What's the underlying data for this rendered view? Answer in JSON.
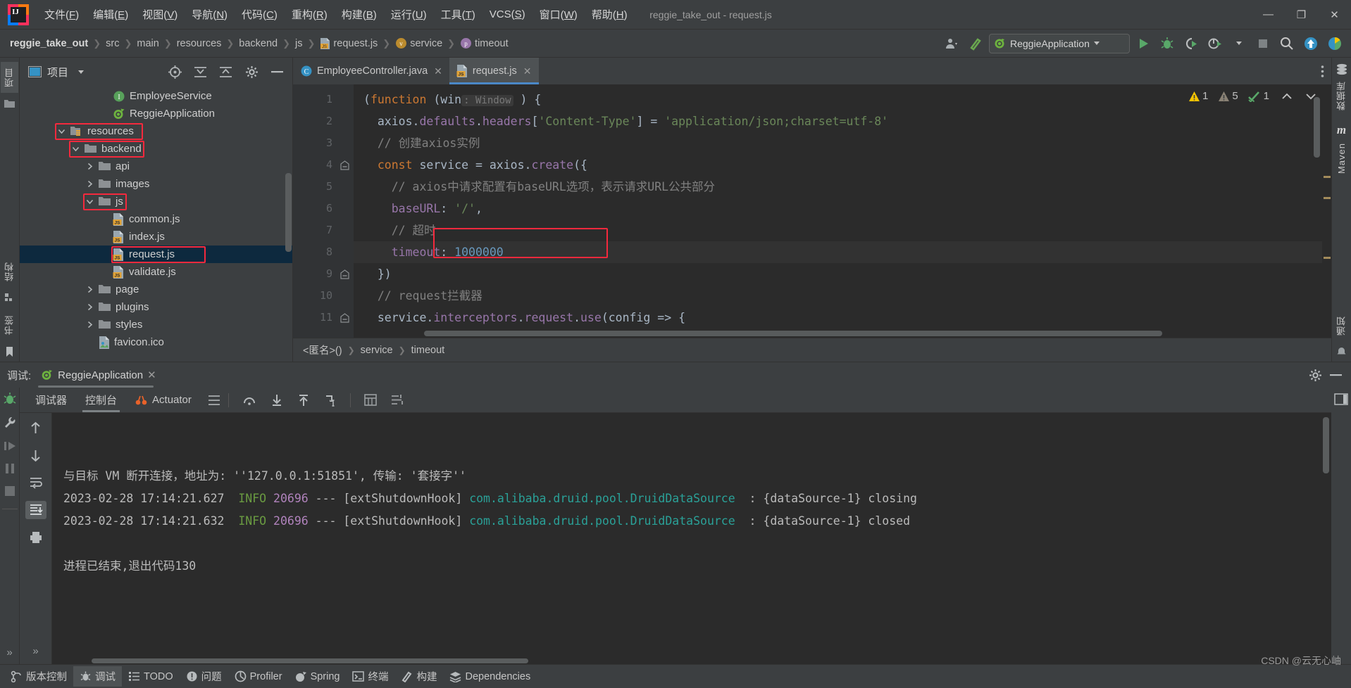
{
  "titlebar": {
    "menus": [
      {
        "label": "文件(F)",
        "mn": "F"
      },
      {
        "label": "编辑(E)",
        "mn": "E"
      },
      {
        "label": "视图(V)",
        "mn": "V"
      },
      {
        "label": "导航(N)",
        "mn": "N"
      },
      {
        "label": "代码(C)",
        "mn": "C"
      },
      {
        "label": "重构(R)",
        "mn": "R"
      },
      {
        "label": "构建(B)",
        "mn": "B"
      },
      {
        "label": "运行(U)",
        "mn": "U"
      },
      {
        "label": "工具(T)",
        "mn": "T"
      },
      {
        "label": "VCS(S)",
        "mn": "S"
      },
      {
        "label": "窗口(W)",
        "mn": "W"
      },
      {
        "label": "帮助(H)",
        "mn": "H"
      }
    ],
    "window_title": "reggie_take_out - request.js",
    "minimize": "—",
    "maximize": "❐",
    "close": "✕"
  },
  "navbar": {
    "crumbs": [
      "reggie_take_out",
      "src",
      "main",
      "resources",
      "backend",
      "js",
      "request.js",
      "service",
      "timeout"
    ],
    "run_config": "ReggieApplication",
    "icons": [
      "profile-icon",
      "hammer-icon",
      "run-icon",
      "debug-icon",
      "coverage-icon",
      "profiler-icon",
      "stop-icon",
      "search-icon",
      "update-icon",
      "ide-icon"
    ]
  },
  "project_panel": {
    "title": "项目",
    "tree": [
      {
        "label": "EmployeeService",
        "indent": 5,
        "icon": "interface-icon",
        "arrow": "none",
        "highlight": false
      },
      {
        "label": "ReggieApplication",
        "indent": 5,
        "icon": "spring-icon",
        "arrow": "none",
        "highlight": false
      },
      {
        "label": "resources",
        "indent": 2,
        "icon": "resource-folder-icon",
        "arrow": "down",
        "highlight": true
      },
      {
        "label": "backend",
        "indent": 3,
        "icon": "folder-icon",
        "arrow": "down",
        "highlight": true
      },
      {
        "label": "api",
        "indent": 4,
        "icon": "folder-icon",
        "arrow": "right",
        "highlight": false
      },
      {
        "label": "images",
        "indent": 4,
        "icon": "folder-icon",
        "arrow": "right",
        "highlight": false
      },
      {
        "label": "js",
        "indent": 4,
        "icon": "folder-icon",
        "arrow": "down",
        "highlight": true
      },
      {
        "label": "common.js",
        "indent": 5,
        "icon": "js-file-icon",
        "arrow": "none",
        "highlight": false
      },
      {
        "label": "index.js",
        "indent": 5,
        "icon": "js-file-icon",
        "arrow": "none",
        "highlight": false
      },
      {
        "label": "request.js",
        "indent": 5,
        "icon": "js-file-icon",
        "arrow": "none",
        "highlight": true,
        "selected": true
      },
      {
        "label": "validate.js",
        "indent": 5,
        "icon": "js-file-icon",
        "arrow": "none",
        "highlight": false
      },
      {
        "label": "page",
        "indent": 4,
        "icon": "folder-icon",
        "arrow": "right",
        "highlight": false
      },
      {
        "label": "plugins",
        "indent": 4,
        "icon": "folder-icon",
        "arrow": "right",
        "highlight": false
      },
      {
        "label": "styles",
        "indent": 4,
        "icon": "folder-icon",
        "arrow": "right",
        "highlight": false
      },
      {
        "label": "favicon.ico",
        "indent": 4,
        "icon": "image-file-icon",
        "arrow": "none",
        "highlight": false
      }
    ]
  },
  "editor": {
    "tabs": [
      {
        "label": "EmployeeController.java",
        "icon": "java-class-icon",
        "active": false
      },
      {
        "label": "request.js",
        "icon": "js-file-icon",
        "active": true
      }
    ],
    "lines": [
      {
        "n": "1",
        "fold": "",
        "cur": false,
        "html": "<span class=\"punct\">(</span><span class=\"kw\">function</span> <span class=\"punct\">(</span><span class=\"id\">win</span><span class=\"type-hint\">: Window</span> <span class=\"punct\">) {</span>"
      },
      {
        "n": "2",
        "fold": "",
        "cur": false,
        "html": "  <span class=\"id\">axios</span><span class=\"punct\">.</span><span class=\"prop\">defaults</span><span class=\"punct\">.</span><span class=\"prop\">headers</span><span class=\"punct\">[</span><span class=\"str\">'Content-Type'</span><span class=\"punct\">] = </span><span class=\"str\">'application/json;charset=utf-8'</span>"
      },
      {
        "n": "3",
        "fold": "",
        "cur": false,
        "html": "  <span class=\"cmt\">// 创建axios实例</span>"
      },
      {
        "n": "4",
        "fold": "-",
        "cur": false,
        "html": "  <span class=\"kw\">const</span> <span class=\"id\">service</span> <span class=\"punct\">=</span> <span class=\"id\">axios</span><span class=\"punct\">.</span><span class=\"prop\">create</span><span class=\"punct\">({</span>"
      },
      {
        "n": "5",
        "fold": "",
        "cur": false,
        "html": "    <span class=\"cmt\">// axios中请求配置有baseURL选项，表示请求URL公共部分</span>"
      },
      {
        "n": "6",
        "fold": "",
        "cur": false,
        "html": "    <span class=\"prop\">baseURL</span><span class=\"punct\">: </span><span class=\"str\">'/'</span><span class=\"punct\">,</span>"
      },
      {
        "n": "7",
        "fold": "",
        "cur": false,
        "html": "    <span class=\"cmt\">// 超时</span>"
      },
      {
        "n": "8",
        "fold": "",
        "cur": true,
        "html": "    <span class=\"prop\">timeout</span><span class=\"punct\">: </span><span class=\"num\">1000000</span>"
      },
      {
        "n": "9",
        "fold": "-",
        "cur": false,
        "html": "  <span class=\"punct\">})</span>"
      },
      {
        "n": "10",
        "fold": "",
        "cur": false,
        "html": "  <span class=\"cmt\">// request拦截器</span>"
      },
      {
        "n": "11",
        "fold": "-",
        "cur": false,
        "html": "  <span class=\"id\">service</span><span class=\"punct\">.</span><span class=\"prop\">interceptors</span><span class=\"punct\">.</span><span class=\"prop\">request</span><span class=\"punct\">.</span><span class=\"prop\">use</span><span class=\"punct\">(</span><span class=\"id\">config</span> <span class=\"punct\">=> {</span>"
      }
    ],
    "inspections": {
      "warnings": "1",
      "weak_warnings": "5",
      "typos": "1"
    },
    "breadcrumb": [
      "<匿名>()",
      "service",
      "timeout"
    ]
  },
  "debug": {
    "title": "调试:",
    "session": "ReggieApplication",
    "tabs": [
      {
        "label": "调试器",
        "icon": "",
        "active": false
      },
      {
        "label": "控制台",
        "icon": "",
        "active": true
      },
      {
        "label": "Actuator",
        "icon": "actuator-icon",
        "active": false
      }
    ],
    "console_lines": [
      [
        {
          "t": "与目标 VM 断开连接，地址为: ''127.0.0.1:51851', 传输: '套接字''",
          "c": "c-plain"
        }
      ],
      [
        {
          "t": "2023-02-28 17:14:21.627 ",
          "c": "c-plain"
        },
        {
          "t": " INFO",
          "c": "c-info"
        },
        {
          "t": " 20696",
          "c": "c-pid"
        },
        {
          "t": " --- [extShutdownHook] ",
          "c": "c-plain"
        },
        {
          "t": "com.alibaba.druid.pool.DruidDataSource",
          "c": "c-class"
        },
        {
          "t": "  : {dataSource-1} closing",
          "c": "c-plain"
        }
      ],
      [
        {
          "t": "2023-02-28 17:14:21.632 ",
          "c": "c-plain"
        },
        {
          "t": " INFO",
          "c": "c-info"
        },
        {
          "t": " 20696",
          "c": "c-pid"
        },
        {
          "t": " --- [extShutdownHook] ",
          "c": "c-plain"
        },
        {
          "t": "com.alibaba.druid.pool.DruidDataSource",
          "c": "c-class"
        },
        {
          "t": "  : {dataSource-1} closed",
          "c": "c-plain"
        }
      ],
      [],
      [
        {
          "t": "进程已结束,退出代码130",
          "c": "c-plain"
        }
      ]
    ]
  },
  "left_strips": {
    "top_tabs": [
      "项目"
    ],
    "bottom_tabs": [
      "结构",
      "书签"
    ]
  },
  "right_strips": {
    "tabs": [
      "数据库",
      "Maven",
      "通知"
    ]
  },
  "statusbar": {
    "items": [
      {
        "label": "版本控制",
        "icon": "vcs-icon",
        "active": false
      },
      {
        "label": "调试",
        "icon": "debug-icon",
        "active": true
      },
      {
        "label": "TODO",
        "icon": "todo-icon",
        "active": false
      },
      {
        "label": "问题",
        "icon": "problems-icon",
        "active": false
      },
      {
        "label": "Profiler",
        "icon": "profiler-icon",
        "active": false
      },
      {
        "label": "Spring",
        "icon": "spring-icon",
        "active": false
      },
      {
        "label": "终端",
        "icon": "terminal-icon",
        "active": false
      },
      {
        "label": "构建",
        "icon": "build-icon",
        "active": false
      },
      {
        "label": "Dependencies",
        "icon": "dependencies-icon",
        "active": false
      }
    ],
    "watermark": "CSDN @云无心岫"
  },
  "colors": {
    "accent": "#4a88c7",
    "highlight_box": "#f5293d",
    "selection": "#0d293e",
    "editor_bg": "#2b2b2b",
    "panel_bg": "#3c3f41"
  }
}
